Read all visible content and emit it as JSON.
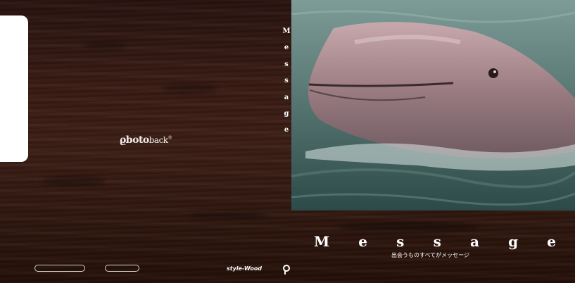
{
  "logo": {
    "bold": "ϱboto",
    "light": "back",
    "mark": "®"
  },
  "vertical_title": [
    "M",
    "e",
    "s",
    "s",
    "a",
    "g",
    "e"
  ],
  "message": {
    "letters": [
      "M",
      "e",
      "s",
      "s",
      "a",
      "g",
      "e"
    ],
    "subtitle": "出会うものすべてがメッセージ"
  },
  "footer": {
    "style_label": "style-Wood",
    "brand_icon": "photoback-p-icon"
  },
  "photo": {
    "subject_icon": "dolphin-photo"
  },
  "colors": {
    "wood_dark": "#2a1410",
    "wood_mid": "#3d1f16",
    "text": "#ffffff",
    "water": "#3f615d"
  }
}
